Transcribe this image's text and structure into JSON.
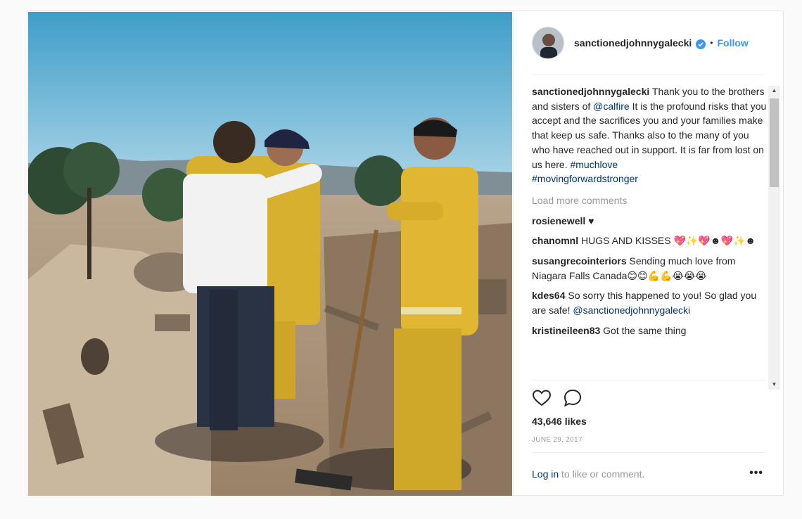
{
  "post": {
    "username": "sanctionedjohnnygalecki",
    "follow_label": "Follow",
    "separator": "•",
    "caption": {
      "user": "sanctionedjohnnygalecki",
      "text_1": " Thank you to the brothers and sisters of ",
      "mention": "@calfire",
      "text_2": " It is the profound risks that you accept and the sacrifices you and your families make that keep us safe. Thanks also to the many of you who have reached out in support. It is far from lost on us here. ",
      "hashtag_1": "#muchlove",
      "hashtag_2": "#movingforwardstronger"
    },
    "load_more": "Load more comments",
    "comments": [
      {
        "user": "rosienewell",
        "text": " ♥"
      },
      {
        "user": "chanomnl",
        "text": " HUGS AND KISSES 💖✨💖☻💖✨☻"
      },
      {
        "user": "susangrecointeriors",
        "text": " Sending much love from Niagara Falls Canada😊😊💪💪😭😭😭"
      },
      {
        "user": "kdes64",
        "text": " So sorry this happened to you! So glad you are safe! ",
        "mention": "@sanctionedjohnnygalecki"
      },
      {
        "user": "kristineileen83",
        "text": " Got the same thing"
      }
    ],
    "likes": "43,646 likes",
    "date": "JUNE 29, 2017",
    "login_link": "Log in",
    "login_text": " to like or comment.",
    "more_label": "•••"
  },
  "icons": {
    "verified": "verified-badge-icon",
    "like": "heart-icon",
    "comment": "comment-bubble-icon",
    "more": "more-options-icon"
  },
  "colors": {
    "link": "#3897f0",
    "mention": "#003569",
    "muted": "#999999",
    "text": "#262626"
  }
}
